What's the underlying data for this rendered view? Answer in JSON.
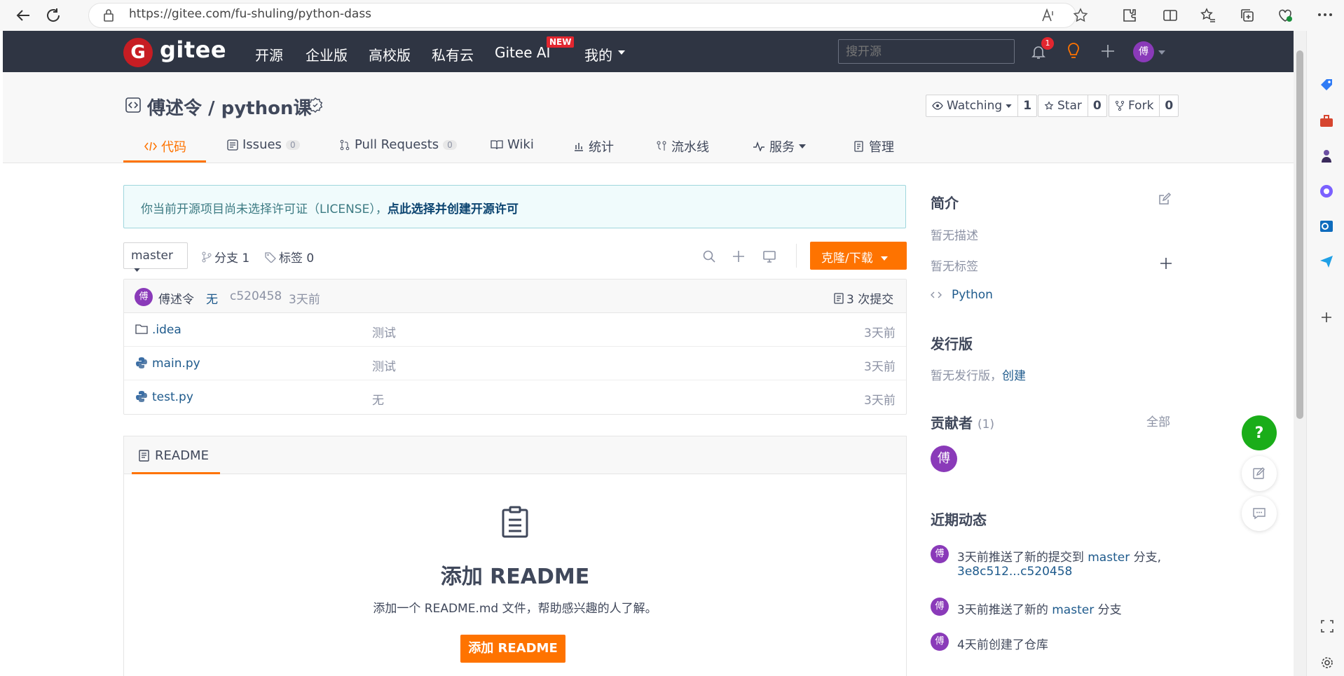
{
  "browser": {
    "url": "https://gitee.com/fu-shuling/python-dass"
  },
  "nav": {
    "logo_mark": "G",
    "logo_text": "gitee",
    "links": [
      "开源",
      "企业版",
      "高校版",
      "私有云",
      "Gitee AI",
      "我的"
    ],
    "new_badge": "NEW",
    "search_placeholder": "搜开源",
    "notification_count": "1",
    "avatar_char": "傅"
  },
  "repo": {
    "title": "傅述令 / python课",
    "watching_label": "Watching",
    "watching_count": "1",
    "star_label": "Star",
    "star_count": "0",
    "fork_label": "Fork",
    "fork_count": "0",
    "tabs": [
      {
        "label": "代码"
      },
      {
        "label": "Issues",
        "count": "0"
      },
      {
        "label": "Pull Requests",
        "count": "0"
      },
      {
        "label": "Wiki"
      },
      {
        "label": "统计"
      },
      {
        "label": "流水线"
      },
      {
        "label": "服务"
      },
      {
        "label": "管理"
      }
    ]
  },
  "license": {
    "text": "你当前开源项目尚未选择许可证（LICENSE），",
    "link": "点此选择并创建开源许可"
  },
  "toolbar": {
    "branch": "master",
    "branches": "分支 1",
    "tags": "标签 0",
    "clone": "克隆/下载"
  },
  "commit": {
    "avatar_char": "傅",
    "author": "傅述令",
    "message": "无",
    "hash": "c520458",
    "time": "3天前",
    "count": "3 次提交"
  },
  "files": [
    {
      "name": ".idea",
      "type": "folder",
      "message": "测试",
      "time": "3天前"
    },
    {
      "name": "main.py",
      "type": "python",
      "message": "测试",
      "time": "3天前"
    },
    {
      "name": "test.py",
      "type": "python",
      "message": "无",
      "time": "3天前"
    }
  ],
  "readme": {
    "tab": "README",
    "title": "添加 README",
    "desc": "添加一个 README.md 文件，帮助感兴趣的人了解。",
    "button": "添加 README"
  },
  "sidebar": {
    "intro_title": "简介",
    "no_desc": "暂无描述",
    "no_tags": "暂无标签",
    "language": "Python",
    "release_title": "发行版",
    "no_release": "暂无发行版，",
    "create": "创建",
    "contributors_title": "贡献者",
    "contributors_count": "(1)",
    "all": "全部",
    "contributor_char": "傅",
    "activity_title": "近期动态",
    "activities": [
      {
        "pre": "3天前推送了新的提交到 ",
        "link": "master",
        "post": " 分支,",
        "line2": "3e8c512...c520458"
      },
      {
        "pre": "3天前推送了新的 ",
        "link": "master",
        "post": " 分支"
      },
      {
        "pre": "4天前创建了仓库",
        "link": "",
        "post": ""
      }
    ]
  },
  "float": {
    "help": "?"
  },
  "colors": {
    "accent": "#fe7300",
    "nav_bg": "#2f3543",
    "avatar": "#8a3ab9",
    "link": "#1e5a8c"
  }
}
